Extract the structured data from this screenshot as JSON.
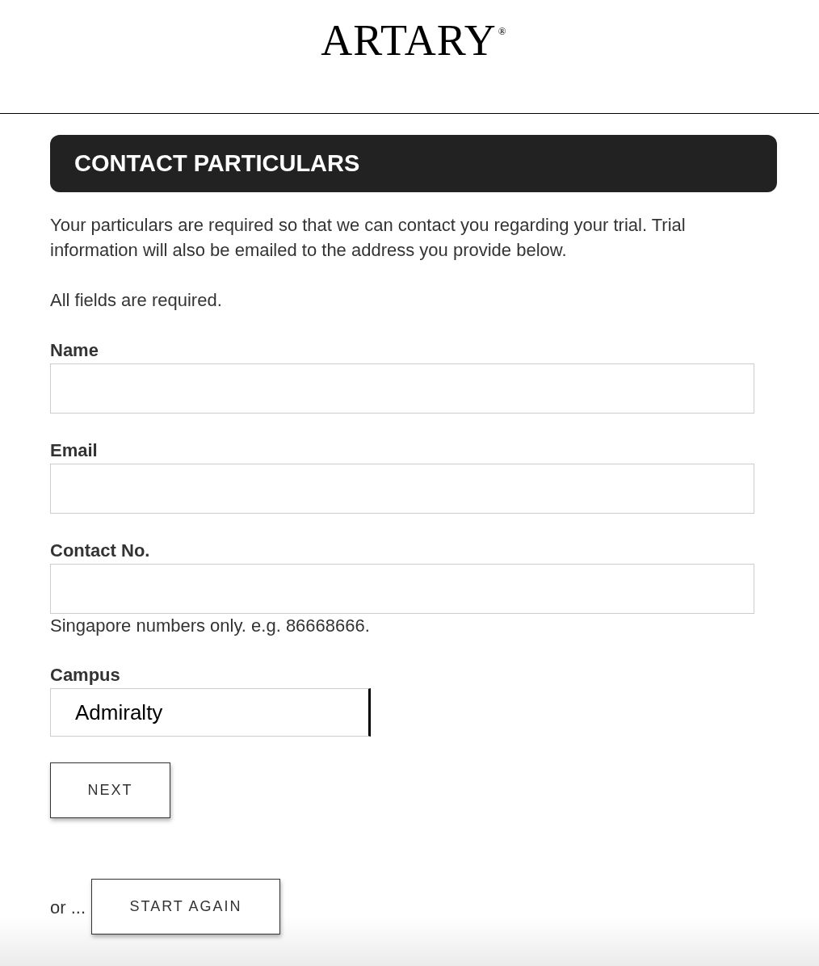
{
  "header": {
    "logo": "ARTARY",
    "logo_mark": "®"
  },
  "section": {
    "title": "CONTACT PARTICULARS",
    "intro": "Your particulars are required so that we can contact you regarding your trial. Trial information will also be emailed to the address you provide below.",
    "note": "All fields are required."
  },
  "fields": [
    {
      "kind": "text",
      "label": "Name"
    },
    {
      "kind": "text",
      "label": "Email"
    },
    {
      "kind": "text",
      "label": "Contact No.",
      "hint": "Singapore numbers only. e.g. 86668666."
    },
    {
      "kind": "select",
      "label": "Campus",
      "value": "Admiralty"
    }
  ],
  "next_button": "NEXT",
  "restart": {
    "prefix": "or ...",
    "button": "START AGAIN"
  }
}
